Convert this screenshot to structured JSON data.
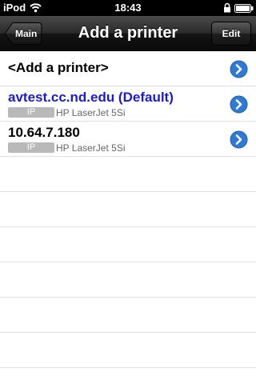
{
  "status_bar": {
    "carrier": "iPod",
    "time": "18:43",
    "icons": [
      "wifi-icon",
      "lock-icon",
      "battery-icon"
    ]
  },
  "nav_bar": {
    "back_label": "Main",
    "title": "Add a printer",
    "edit_label": "Edit"
  },
  "rows": [
    {
      "title": "<Add a printer>"
    },
    {
      "title": "avtest.cc.nd.edu (Default)",
      "type": "IP",
      "model": "HP LaserJet 5Si",
      "default": true
    },
    {
      "title": "10.64.7.180",
      "type": "IP",
      "model": "HP LaserJet 5Si"
    }
  ],
  "colors": {
    "default_printer": "#1b1bd3",
    "disclosure_blue": "#2f7ad6",
    "nav_bar": "#2a2a2a"
  }
}
